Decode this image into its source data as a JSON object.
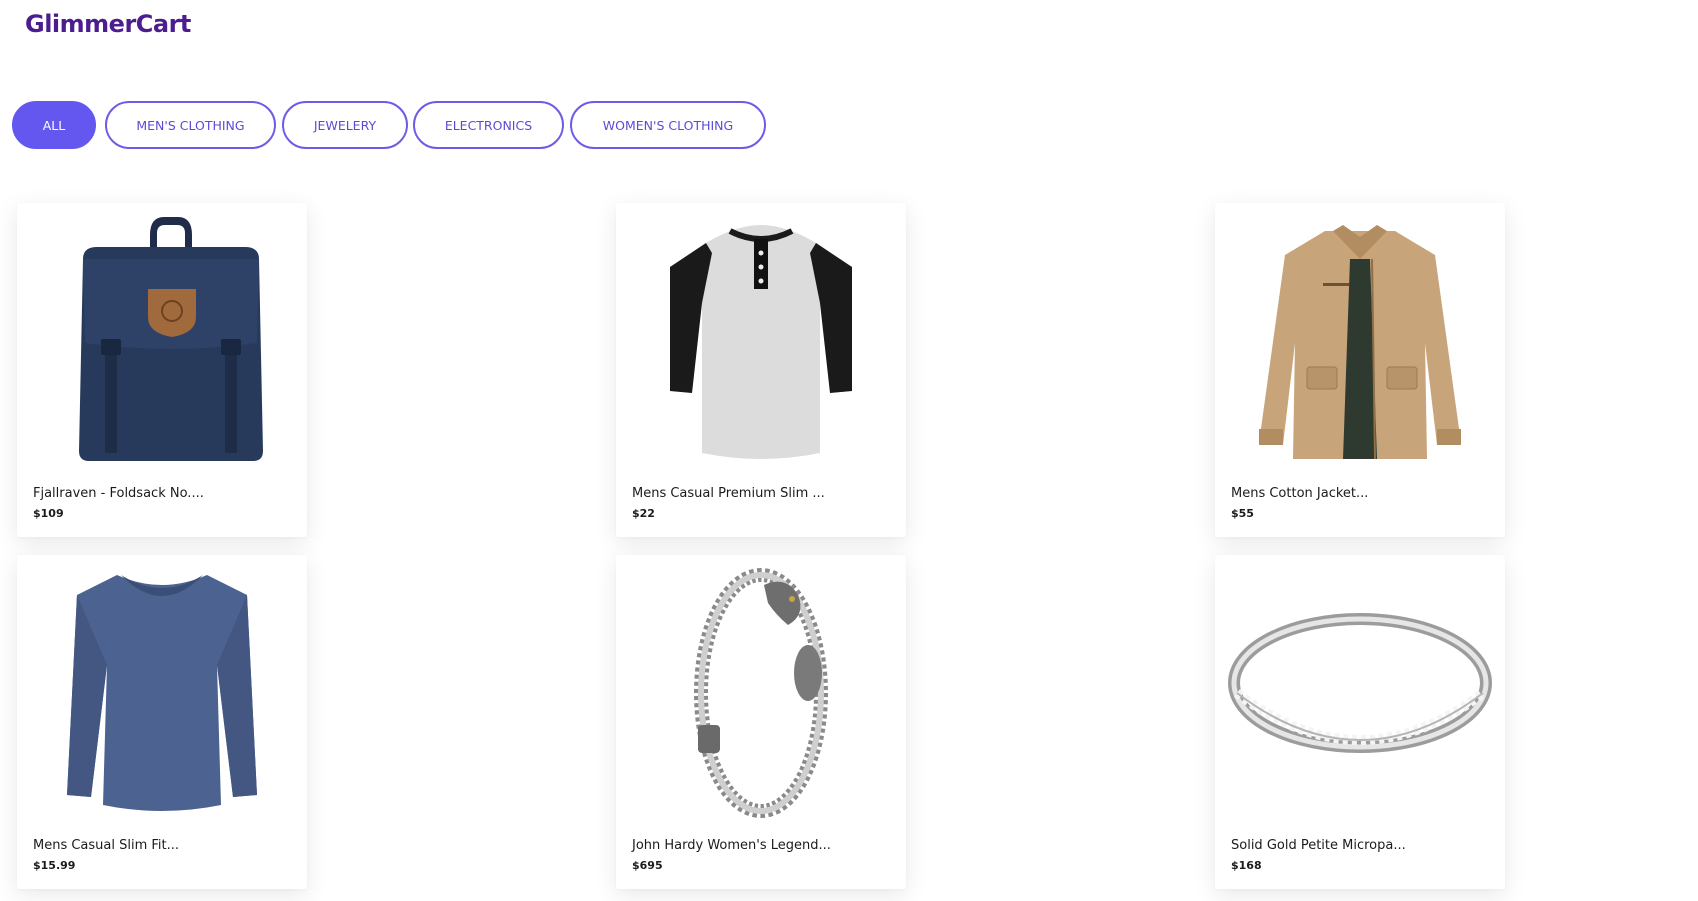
{
  "app": {
    "name": "GlimmerCart"
  },
  "filters": {
    "all": "ALL",
    "mens": "MEN'S CLOTHING",
    "jewelery": "JEWELERY",
    "electronics": "ELECTRONICS",
    "womens": "WOMEN'S CLOTHING"
  },
  "products": [
    {
      "title": "Fjallraven - Foldsack No....",
      "price": "$109"
    },
    {
      "title": "Mens Casual Premium Slim ...",
      "price": "$22"
    },
    {
      "title": "Mens Cotton Jacket...",
      "price": "$55"
    },
    {
      "title": "Mens Casual Slim Fit...",
      "price": "$15.99"
    },
    {
      "title": "John Hardy Women's Legend...",
      "price": "$695"
    },
    {
      "title": "Solid Gold Petite Micropa...",
      "price": "$168"
    }
  ],
  "colors": {
    "accent": "#6457f0",
    "brand": "#4b1d8f"
  }
}
